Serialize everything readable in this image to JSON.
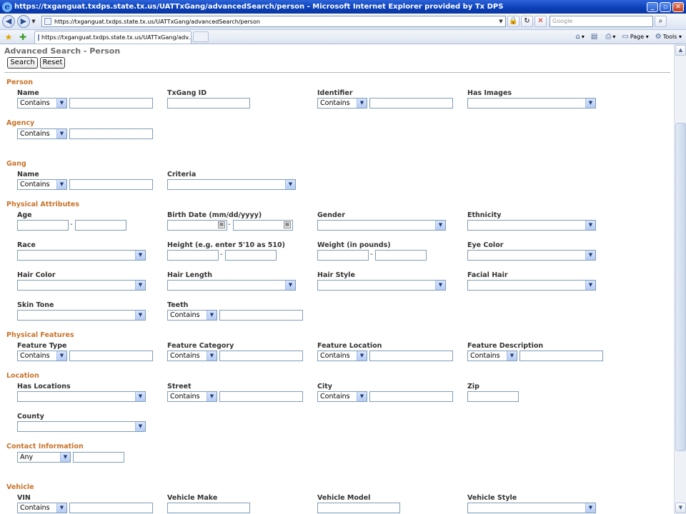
{
  "window": {
    "title": "https://txganguat.txdps.state.tx.us/UATTxGang/advancedSearch/person - Microsoft Internet Explorer provided by Tx DPS",
    "minimize": "_",
    "restore": "▫",
    "close": "✕"
  },
  "browser": {
    "url": "https://txganguat.txdps.state.tx.us/UATTxGang/advancedSearch/person",
    "search_placeholder": "Google",
    "tab_label": "https://txganguat.txdps.state.tx.us/UATTxGang/adv...",
    "page_label": "Page",
    "tools_label": "Tools"
  },
  "page": {
    "title": "Advanced Search - Person",
    "search_button": "Search",
    "reset_button": "Reset",
    "contains": "Contains",
    "any": "Any",
    "dash": "-",
    "sections": {
      "person": "Person",
      "agency": "Agency",
      "gang": "Gang",
      "physical_attributes": "Physical Attributes",
      "physical_features": "Physical Features",
      "location": "Location",
      "contact_information": "Contact Information",
      "vehicle": "Vehicle"
    },
    "labels": {
      "name": "Name",
      "txgang_id": "TxGang ID",
      "identifier": "Identifier",
      "has_images": "Has Images",
      "gang_name": "Name",
      "criteria": "Criteria",
      "age": "Age",
      "birth_date": "Birth Date (mm/dd/yyyy)",
      "gender": "Gender",
      "ethnicity": "Ethnicity",
      "race": "Race",
      "height": "Height (e.g. enter 5'10 as 510)",
      "weight": "Weight (in pounds)",
      "eye_color": "Eye Color",
      "hair_color": "Hair Color",
      "hair_length": "Hair Length",
      "hair_style": "Hair Style",
      "facial_hair": "Facial Hair",
      "skin_tone": "Skin Tone",
      "teeth": "Teeth",
      "feature_type": "Feature Type",
      "feature_category": "Feature Category",
      "feature_location": "Feature Location",
      "feature_description": "Feature Description",
      "has_locations": "Has Locations",
      "street": "Street",
      "city": "City",
      "zip": "Zip",
      "county": "County",
      "vin": "VIN",
      "vehicle_make": "Vehicle Make",
      "vehicle_model": "Vehicle Model",
      "vehicle_style": "Vehicle Style"
    }
  }
}
